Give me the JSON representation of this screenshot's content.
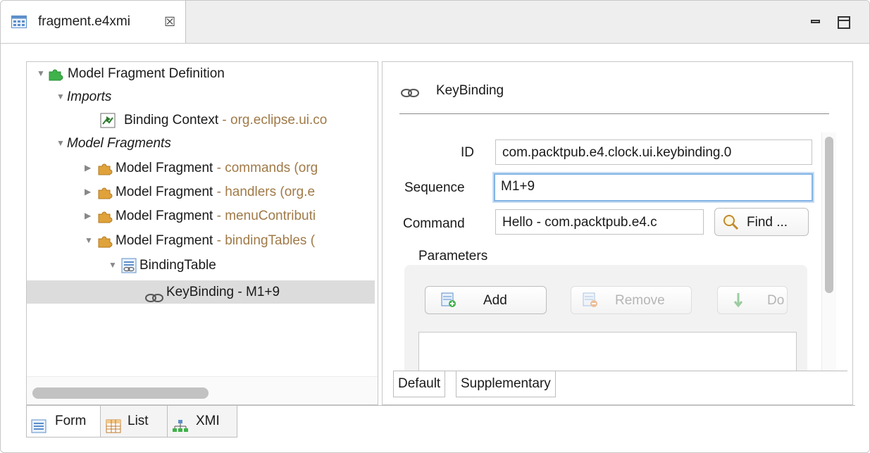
{
  "tab": {
    "title": "fragment.e4xmi",
    "close_glyph": "☒",
    "icon": "model-editor-icon"
  },
  "window": {
    "minimize_icon": "minimize-icon",
    "maximize_icon": "maximize-icon"
  },
  "tree": {
    "root": {
      "label": "Model Fragment Definition"
    },
    "imports": {
      "label": "Imports"
    },
    "binding_context": {
      "label": "Binding Context",
      "detail": " - org.eclipse.ui.co"
    },
    "model_fragments": {
      "label": "Model Fragments"
    },
    "fragments": [
      {
        "label": "Model Fragment",
        "detail": " - commands (org"
      },
      {
        "label": "Model Fragment",
        "detail": " - handlers (org.e"
      },
      {
        "label": "Model Fragment",
        "detail": " - menuContributi"
      },
      {
        "label": "Model Fragment",
        "detail": " - bindingTables ("
      }
    ],
    "binding_table": {
      "label": "BindingTable"
    },
    "keybinding": {
      "label": "KeyBinding - M1+9"
    }
  },
  "detail": {
    "title": "KeyBinding",
    "id_label": "ID",
    "id_value": "com.packtpub.e4.clock.ui.keybinding.0",
    "sequence_label": "Sequence",
    "sequence_value": "M1+9",
    "command_label": "Command",
    "command_value": "Hello - com.packtpub.e4.c",
    "find_label": "Find ...",
    "parameters_label": "Parameters",
    "add_label": "Add",
    "remove_label": "Remove",
    "down_label": "Do"
  },
  "detail_tabs": [
    "Default",
    "Supplementary"
  ],
  "bottom_tabs": [
    "Form",
    "List",
    "XMI"
  ],
  "colors": {
    "detail_text": "#a07a48",
    "selection": "#dcdcdc",
    "focus": "#82b3e6"
  }
}
